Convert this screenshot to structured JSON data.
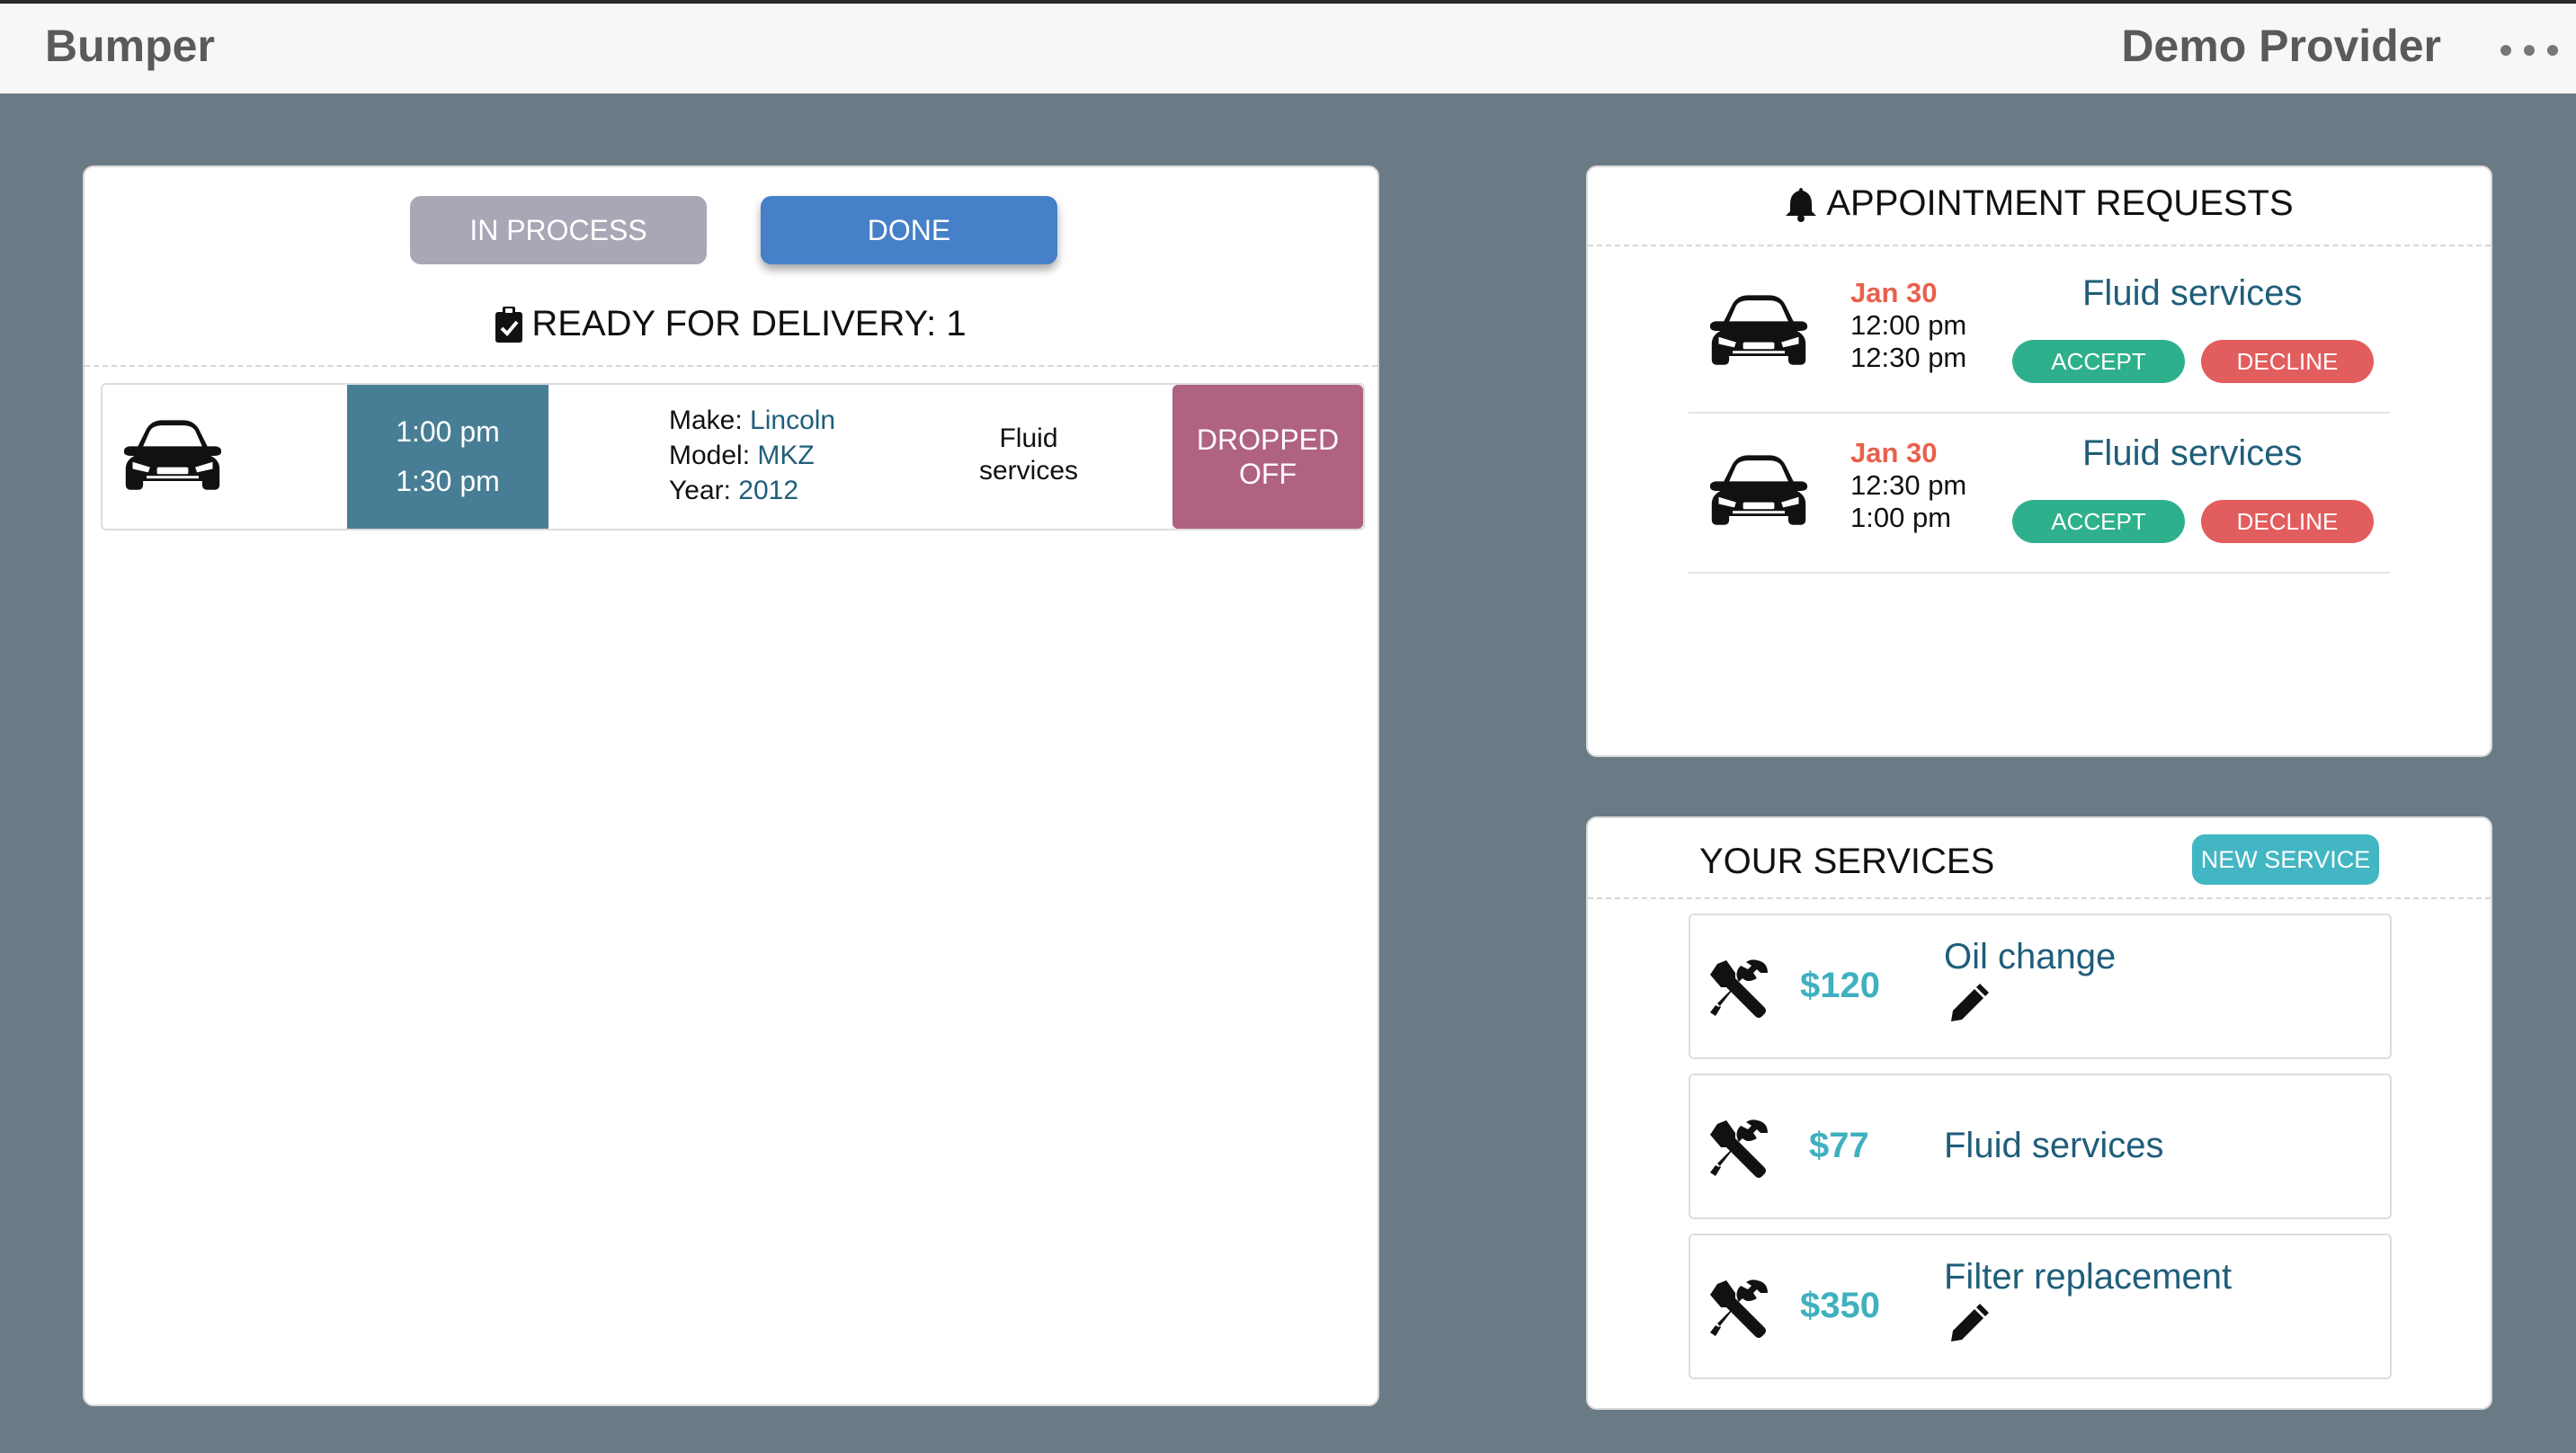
{
  "header": {
    "brand": "Bumper",
    "provider": "Demo Provider"
  },
  "colors": {
    "background": "#6b7b86",
    "in_process_tab": "#aaa6b5",
    "done_tab": "#4580c9",
    "time_block": "#487e95",
    "dropped_off": "#b06282",
    "date_red": "#e8604c",
    "accept": "#2fb08c",
    "decline": "#e25d5d",
    "new_service": "#43b6c3",
    "price": "#3fb0bf",
    "link_teal": "#1f5e7a"
  },
  "left_panel": {
    "tabs": {
      "in_process": "IN PROCESS",
      "done": "DONE"
    },
    "ready_title": "READY FOR DELIVERY: 1",
    "delivery": {
      "start_time": "1:00 pm",
      "end_time": "1:30 pm",
      "make_label": "Make:",
      "make": "Lincoln",
      "model_label": "Model:",
      "model": "MKZ",
      "year_label": "Year:",
      "year": "2012",
      "service": "Fluid services",
      "status": "DROPPED OFF"
    }
  },
  "requests": {
    "title": "APPOINTMENT REQUESTS",
    "items": [
      {
        "date": "Jan 30",
        "start": "12:00 pm",
        "end": "12:30 pm",
        "service": "Fluid services",
        "accept": "ACCEPT",
        "decline": "DECLINE"
      },
      {
        "date": "Jan 30",
        "start": "12:30 pm",
        "end": "1:00 pm",
        "service": "Fluid services",
        "accept": "ACCEPT",
        "decline": "DECLINE"
      }
    ]
  },
  "services": {
    "title": "YOUR SERVICES",
    "new_button": "NEW SERVICE",
    "items": [
      {
        "price": "$120",
        "name": "Oil change"
      },
      {
        "price": "$77",
        "name": "Fluid services"
      },
      {
        "price": "$350",
        "name": "Filter replacement"
      }
    ]
  }
}
